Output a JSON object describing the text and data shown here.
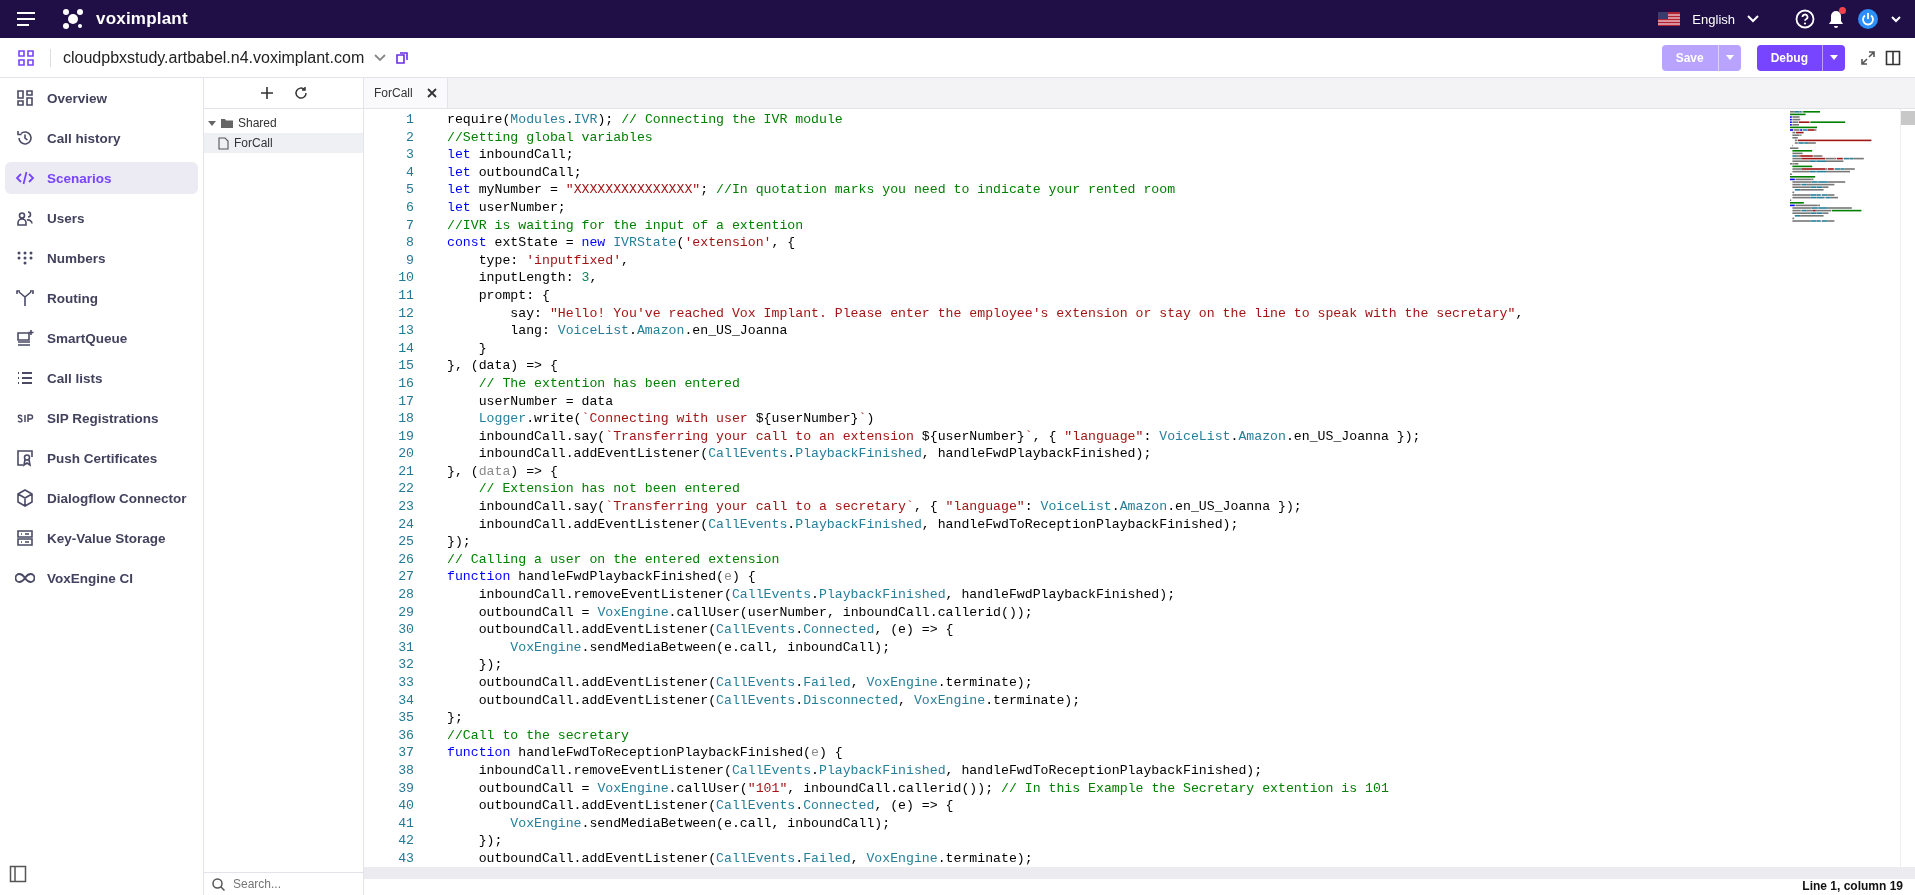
{
  "header": {
    "brand": "voximplant",
    "language": "English"
  },
  "toolbar": {
    "domain": "cloudpbxstudy.artbabel.n4.voximplant.com",
    "buttons": [
      {
        "label": "Save",
        "disabled": true
      },
      {
        "label": "Debug",
        "disabled": false
      }
    ]
  },
  "nav": [
    {
      "label": "Overview",
      "selected": false
    },
    {
      "label": "Call history",
      "selected": false
    },
    {
      "label": "Scenarios",
      "selected": true
    },
    {
      "label": "Users",
      "selected": false
    },
    {
      "label": "Numbers",
      "selected": false
    },
    {
      "label": "Routing",
      "selected": false
    },
    {
      "label": "SmartQueue",
      "selected": false
    },
    {
      "label": "Call lists",
      "selected": false
    },
    {
      "label": "SIP Registrations",
      "selected": false
    },
    {
      "label": "Push Certificates",
      "selected": false
    },
    {
      "label": "Dialogflow Connector",
      "selected": false
    },
    {
      "label": "Key-Value Storage",
      "selected": false
    },
    {
      "label": "VoxEngine CI",
      "selected": false
    }
  ],
  "tree": {
    "folders": [
      {
        "label": "Shared",
        "expanded": true,
        "children": [
          {
            "label": "ForCall",
            "selected": true
          }
        ]
      }
    ],
    "search_placeholder": "Search..."
  },
  "tabs": [
    {
      "label": "ForCall",
      "selected": true
    }
  ],
  "editor": {
    "lines": [
      {
        "number": "1",
        "tokens": [
          {
            "kind": "plain",
            "text": "require("
          },
          {
            "kind": "cls",
            "text": "Modules"
          },
          {
            "kind": "plain",
            "text": "."
          },
          {
            "kind": "cls",
            "text": "IVR"
          },
          {
            "kind": "plain",
            "text": "); "
          },
          {
            "kind": "com",
            "text": "// Connecting the IVR module"
          }
        ]
      },
      {
        "number": "2",
        "tokens": [
          {
            "kind": "com",
            "text": "//Setting global variables"
          }
        ]
      },
      {
        "number": "3",
        "tokens": [
          {
            "kind": "kw",
            "text": "let"
          },
          {
            "kind": "plain",
            "text": " inboundCall;"
          }
        ]
      },
      {
        "number": "4",
        "tokens": [
          {
            "kind": "kw",
            "text": "let"
          },
          {
            "kind": "plain",
            "text": " outboundCall;"
          }
        ]
      },
      {
        "number": "5",
        "tokens": [
          {
            "kind": "kw",
            "text": "let"
          },
          {
            "kind": "plain",
            "text": " myNumber = "
          },
          {
            "kind": "str",
            "text": "\"XXXXXXXXXXXXXXX\""
          },
          {
            "kind": "plain",
            "text": "; "
          },
          {
            "kind": "com",
            "text": "//In quotation marks you need to indicate your rented room"
          }
        ]
      },
      {
        "number": "6",
        "tokens": [
          {
            "kind": "kw",
            "text": "let"
          },
          {
            "kind": "plain",
            "text": " userNumber;"
          }
        ]
      },
      {
        "number": "7",
        "tokens": [
          {
            "kind": "com",
            "text": "//IVR is waiting for the input of a extention"
          }
        ]
      },
      {
        "number": "8",
        "tokens": [
          {
            "kind": "kw",
            "text": "const"
          },
          {
            "kind": "plain",
            "text": " extState = "
          },
          {
            "kind": "kw",
            "text": "new"
          },
          {
            "kind": "cls",
            "text": " IVRState"
          },
          {
            "kind": "plain",
            "text": "("
          },
          {
            "kind": "str",
            "text": "'extension'"
          },
          {
            "kind": "plain",
            "text": ", {"
          }
        ]
      },
      {
        "number": "9",
        "tokens": [
          {
            "kind": "plain",
            "text": "    type: "
          },
          {
            "kind": "str",
            "text": "'inputfixed'"
          },
          {
            "kind": "plain",
            "text": ","
          }
        ]
      },
      {
        "number": "10",
        "tokens": [
          {
            "kind": "plain",
            "text": "    inputLength: "
          },
          {
            "kind": "num",
            "text": "3"
          },
          {
            "kind": "plain",
            "text": ","
          }
        ]
      },
      {
        "number": "11",
        "tokens": [
          {
            "kind": "plain",
            "text": "    prompt: {"
          }
        ]
      },
      {
        "number": "12",
        "tokens": [
          {
            "kind": "plain",
            "text": "        say: "
          },
          {
            "kind": "str",
            "text": "\"Hello! You've reached Vox Implant. Please enter the employee's extension or stay on the line to speak with the secretary\""
          },
          {
            "kind": "plain",
            "text": ","
          }
        ]
      },
      {
        "number": "13",
        "tokens": [
          {
            "kind": "plain",
            "text": "        lang: "
          },
          {
            "kind": "cls",
            "text": "VoiceList"
          },
          {
            "kind": "plain",
            "text": "."
          },
          {
            "kind": "cls",
            "text": "Amazon"
          },
          {
            "kind": "plain",
            "text": ".en_US_Joanna"
          }
        ]
      },
      {
        "number": "14",
        "tokens": [
          {
            "kind": "plain",
            "text": "    }"
          }
        ]
      },
      {
        "number": "15",
        "tokens": [
          {
            "kind": "plain",
            "text": "}, (data) => {"
          }
        ]
      },
      {
        "number": "16",
        "tokens": [
          {
            "kind": "com",
            "text": "    // The extention has been entered"
          }
        ]
      },
      {
        "number": "17",
        "tokens": [
          {
            "kind": "plain",
            "text": "    userNumber = data"
          }
        ]
      },
      {
        "number": "18",
        "tokens": [
          {
            "kind": "cls",
            "text": "    Logger"
          },
          {
            "kind": "plain",
            "text": ".write("
          },
          {
            "kind": "str",
            "text": "`Connecting with user "
          },
          {
            "kind": "plain",
            "text": "${userNumber}"
          },
          {
            "kind": "str",
            "text": "`"
          },
          {
            "kind": "plain",
            "text": ")"
          }
        ]
      },
      {
        "number": "19",
        "tokens": [
          {
            "kind": "plain",
            "text": "    inboundCall.say("
          },
          {
            "kind": "str",
            "text": "`Transferring your call to an extension "
          },
          {
            "kind": "plain",
            "text": "${userNumber}"
          },
          {
            "kind": "str",
            "text": "`"
          },
          {
            "kind": "plain",
            "text": ", { "
          },
          {
            "kind": "str",
            "text": "\"language\""
          },
          {
            "kind": "plain",
            "text": ": "
          },
          {
            "kind": "cls",
            "text": "VoiceList"
          },
          {
            "kind": "plain",
            "text": "."
          },
          {
            "kind": "cls",
            "text": "Amazon"
          },
          {
            "kind": "plain",
            "text": ".en_US_Joanna });"
          }
        ]
      },
      {
        "number": "20",
        "tokens": [
          {
            "kind": "plain",
            "text": "    inboundCall.addEventListener("
          },
          {
            "kind": "cls",
            "text": "CallEvents"
          },
          {
            "kind": "plain",
            "text": "."
          },
          {
            "kind": "cls",
            "text": "PlaybackFinished"
          },
          {
            "kind": "plain",
            "text": ", handleFwdPlaybackFinished);"
          }
        ]
      },
      {
        "number": "21",
        "tokens": [
          {
            "kind": "plain",
            "text": "}, ("
          },
          {
            "kind": "dim",
            "text": "data"
          },
          {
            "kind": "plain",
            "text": ") => {"
          }
        ]
      },
      {
        "number": "22",
        "tokens": [
          {
            "kind": "com",
            "text": "    // Extension has not been entered"
          }
        ]
      },
      {
        "number": "23",
        "tokens": [
          {
            "kind": "plain",
            "text": "    inboundCall.say("
          },
          {
            "kind": "str",
            "text": "`Transferring your call to a secretary`"
          },
          {
            "kind": "plain",
            "text": ", { "
          },
          {
            "kind": "str",
            "text": "\"language\""
          },
          {
            "kind": "plain",
            "text": ": "
          },
          {
            "kind": "cls",
            "text": "VoiceList"
          },
          {
            "kind": "plain",
            "text": "."
          },
          {
            "kind": "cls",
            "text": "Amazon"
          },
          {
            "kind": "plain",
            "text": ".en_US_Joanna });"
          }
        ]
      },
      {
        "number": "24",
        "tokens": [
          {
            "kind": "plain",
            "text": "    inboundCall.addEventListener("
          },
          {
            "kind": "cls",
            "text": "CallEvents"
          },
          {
            "kind": "plain",
            "text": "."
          },
          {
            "kind": "cls",
            "text": "PlaybackFinished"
          },
          {
            "kind": "plain",
            "text": ", handleFwdToReceptionPlaybackFinished);"
          }
        ]
      },
      {
        "number": "25",
        "tokens": [
          {
            "kind": "plain",
            "text": "});"
          }
        ]
      },
      {
        "number": "26",
        "tokens": [
          {
            "kind": "com",
            "text": "// Calling a user on the entered extension"
          }
        ]
      },
      {
        "number": "27",
        "tokens": [
          {
            "kind": "kw",
            "text": "function"
          },
          {
            "kind": "plain",
            "text": " handleFwdPlaybackFinished("
          },
          {
            "kind": "dim",
            "text": "e"
          },
          {
            "kind": "plain",
            "text": ") {"
          }
        ]
      },
      {
        "number": "28",
        "tokens": [
          {
            "kind": "plain",
            "text": "    inboundCall.removeEventListener("
          },
          {
            "kind": "cls",
            "text": "CallEvents"
          },
          {
            "kind": "plain",
            "text": "."
          },
          {
            "kind": "cls",
            "text": "PlaybackFinished"
          },
          {
            "kind": "plain",
            "text": ", handleFwdPlaybackFinished);"
          }
        ]
      },
      {
        "number": "29",
        "tokens": [
          {
            "kind": "plain",
            "text": "    outboundCall = "
          },
          {
            "kind": "cls",
            "text": "VoxEngine"
          },
          {
            "kind": "plain",
            "text": ".callUser(userNumber, inboundCall.callerid());"
          }
        ]
      },
      {
        "number": "30",
        "tokens": [
          {
            "kind": "plain",
            "text": "    outboundCall.addEventListener("
          },
          {
            "kind": "cls",
            "text": "CallEvents"
          },
          {
            "kind": "plain",
            "text": "."
          },
          {
            "kind": "cls",
            "text": "Connected"
          },
          {
            "kind": "plain",
            "text": ", (e) => {"
          }
        ]
      },
      {
        "number": "31",
        "tokens": [
          {
            "kind": "cls",
            "text": "        VoxEngine"
          },
          {
            "kind": "plain",
            "text": ".sendMediaBetween(e.call, inboundCall);"
          }
        ]
      },
      {
        "number": "32",
        "tokens": [
          {
            "kind": "plain",
            "text": "    });"
          }
        ]
      },
      {
        "number": "33",
        "tokens": [
          {
            "kind": "plain",
            "text": "    outboundCall.addEventListener("
          },
          {
            "kind": "cls",
            "text": "CallEvents"
          },
          {
            "kind": "plain",
            "text": "."
          },
          {
            "kind": "cls",
            "text": "Failed"
          },
          {
            "kind": "plain",
            "text": ", "
          },
          {
            "kind": "cls",
            "text": "VoxEngine"
          },
          {
            "kind": "plain",
            "text": ".terminate);"
          }
        ]
      },
      {
        "number": "34",
        "tokens": [
          {
            "kind": "plain",
            "text": "    outboundCall.addEventListener("
          },
          {
            "kind": "cls",
            "text": "CallEvents"
          },
          {
            "kind": "plain",
            "text": "."
          },
          {
            "kind": "cls",
            "text": "Disconnected"
          },
          {
            "kind": "plain",
            "text": ", "
          },
          {
            "kind": "cls",
            "text": "VoxEngine"
          },
          {
            "kind": "plain",
            "text": ".terminate);"
          }
        ]
      },
      {
        "number": "35",
        "tokens": [
          {
            "kind": "plain",
            "text": "};"
          }
        ]
      },
      {
        "number": "36",
        "tokens": [
          {
            "kind": "com",
            "text": "//Call to the secretary"
          }
        ]
      },
      {
        "number": "37",
        "tokens": [
          {
            "kind": "kw",
            "text": "function"
          },
          {
            "kind": "plain",
            "text": " handleFwdToReceptionPlaybackFinished("
          },
          {
            "kind": "dim",
            "text": "e"
          },
          {
            "kind": "plain",
            "text": ") {"
          }
        ]
      },
      {
        "number": "38",
        "tokens": [
          {
            "kind": "plain",
            "text": "    inboundCall.removeEventListener("
          },
          {
            "kind": "cls",
            "text": "CallEvents"
          },
          {
            "kind": "plain",
            "text": "."
          },
          {
            "kind": "cls",
            "text": "PlaybackFinished"
          },
          {
            "kind": "plain",
            "text": ", handleFwdToReceptionPlaybackFinished);"
          }
        ]
      },
      {
        "number": "39",
        "tokens": [
          {
            "kind": "plain",
            "text": "    outboundCall = "
          },
          {
            "kind": "cls",
            "text": "VoxEngine"
          },
          {
            "kind": "plain",
            "text": ".callUser("
          },
          {
            "kind": "str",
            "text": "\"101\""
          },
          {
            "kind": "plain",
            "text": ", inboundCall.callerid()); "
          },
          {
            "kind": "com",
            "text": "// In this Example the Secretary extention is 101"
          }
        ]
      },
      {
        "number": "40",
        "tokens": [
          {
            "kind": "plain",
            "text": "    outboundCall.addEventListener("
          },
          {
            "kind": "cls",
            "text": "CallEvents"
          },
          {
            "kind": "plain",
            "text": "."
          },
          {
            "kind": "cls",
            "text": "Connected"
          },
          {
            "kind": "plain",
            "text": ", (e) => {"
          }
        ]
      },
      {
        "number": "41",
        "tokens": [
          {
            "kind": "cls",
            "text": "        VoxEngine"
          },
          {
            "kind": "plain",
            "text": ".sendMediaBetween(e.call, inboundCall);"
          }
        ]
      },
      {
        "number": "42",
        "tokens": [
          {
            "kind": "plain",
            "text": "    });"
          }
        ]
      },
      {
        "number": "43",
        "tokens": [
          {
            "kind": "plain",
            "text": "    outboundCall.addEventListener("
          },
          {
            "kind": "cls",
            "text": "CallEvents"
          },
          {
            "kind": "plain",
            "text": "."
          },
          {
            "kind": "cls",
            "text": "Failed"
          },
          {
            "kind": "plain",
            "text": ", "
          },
          {
            "kind": "cls",
            "text": "VoxEngine"
          },
          {
            "kind": "plain",
            "text": ".terminate);"
          }
        ]
      }
    ],
    "status": "Line 1, column 19"
  }
}
